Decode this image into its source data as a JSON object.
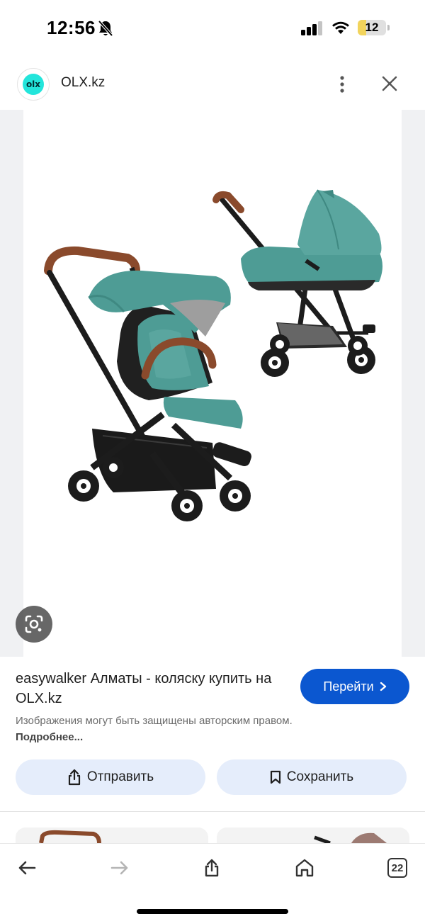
{
  "status_bar": {
    "time": "12:56",
    "battery_level": "12",
    "icons": [
      "bell-slash-icon",
      "signal-icon",
      "wifi-icon",
      "battery-icon"
    ]
  },
  "header": {
    "site_name": "OLX.kz",
    "logo_text": "olx",
    "icons": [
      "more-vertical-icon",
      "close-icon"
    ]
  },
  "image": {
    "lens_icon": "google-lens-icon"
  },
  "result": {
    "title": "easywalker Алматы - коляску купить на OLX.kz",
    "visit_label": "Перейти",
    "copyright_text": "Изображения могут быть защищены авторским правом.",
    "copyright_link": "Подробнее..."
  },
  "actions": {
    "send_label": "Отправить",
    "save_label": "Сохранить"
  },
  "toolbar": {
    "tab_count": "22",
    "icons": [
      "back-arrow-icon",
      "forward-arrow-icon",
      "share-icon",
      "home-icon",
      "tabs-icon"
    ]
  },
  "colors": {
    "accent": "#0b57d0",
    "action_bg": "#e5edfb",
    "stroller_teal": "#4e9c95",
    "handle_brown": "#8a4a2c",
    "battery": "#f2d45c"
  }
}
